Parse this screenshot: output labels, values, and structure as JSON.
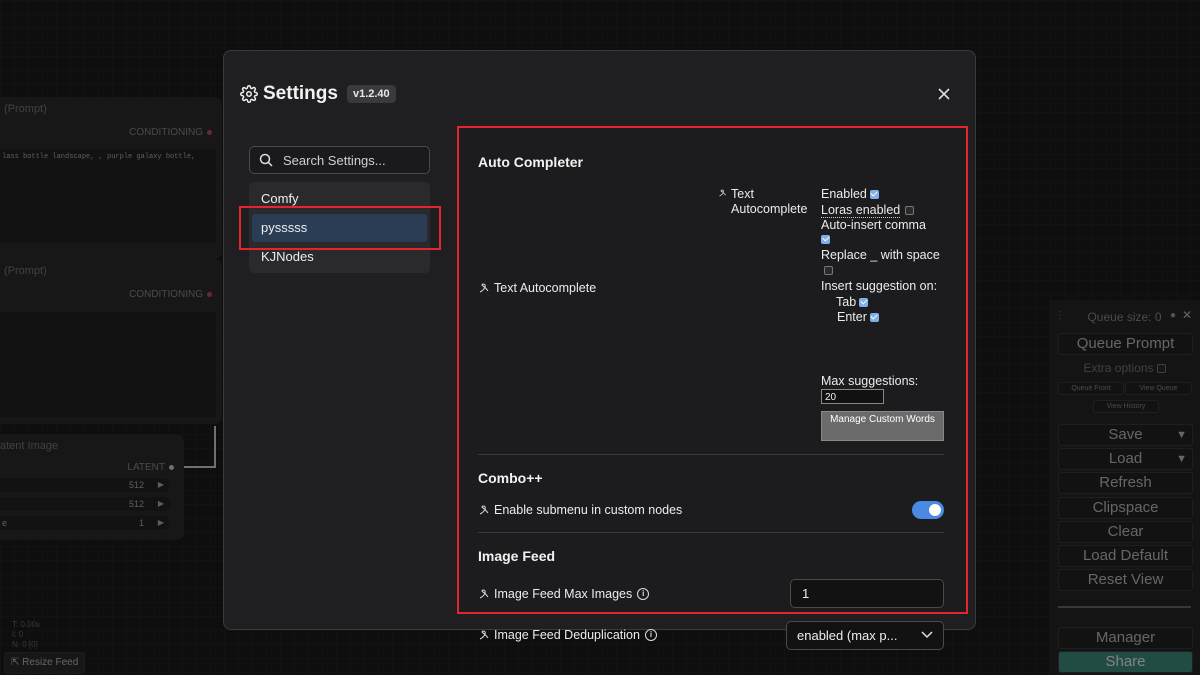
{
  "background": {
    "node1": {
      "title": "(Prompt)",
      "output": "CONDITIONING",
      "prompt_text": "lass bottle landscape, , purple galaxy bottle,"
    },
    "node2": {
      "title": "(Prompt)",
      "output": "CONDITIONING"
    },
    "node3": {
      "title": "atent Image",
      "output": "LATENT",
      "width": "512",
      "height": "512",
      "batch": "1",
      "batch_label": "e"
    },
    "stats": [
      "T: 0.00s",
      "I: 0",
      "N: 0 [0]"
    ],
    "resize_feed": "Resize Feed",
    "accent_colors": {
      "conditioning_dot": "#c04a5a",
      "latent_dot": "#c8c8c8"
    }
  },
  "queue_menu": {
    "queue_size": "Queue size: 0",
    "queue_prompt": "Queue Prompt",
    "extra_options": "Extra options",
    "queue_front": "Queue Front",
    "view_queue": "View Queue",
    "view_history": "View History",
    "save": "Save",
    "load": "Load",
    "refresh": "Refresh",
    "clipspace": "Clipspace",
    "clear": "Clear",
    "load_default": "Load Default",
    "reset_view": "Reset View",
    "manager": "Manager",
    "share": "Share",
    "share_color": "#3c8a7a"
  },
  "settings": {
    "title": "Settings",
    "version": "v1.2.40",
    "search_placeholder": "Search Settings...",
    "categories": [
      "Comfy",
      "pysssss",
      "KJNodes"
    ],
    "selected_category": "pysssss",
    "highlight_color": "#e3262b",
    "sections": {
      "auto_completer": {
        "heading": "Auto Completer",
        "setting_label": "Text Autocomplete",
        "sub_label": "Text Autocomplete",
        "enabled": "Enabled",
        "enabled_checked": true,
        "loras_enabled": "Loras enabled",
        "loras_checked": false,
        "auto_insert_comma": "Auto-insert comma",
        "comma_checked": true,
        "replace_underscore": "Replace _ with space",
        "replace_checked": false,
        "insert_on": "Insert suggestion on:",
        "tab": "Tab",
        "tab_checked": true,
        "enter": "Enter",
        "enter_checked": true,
        "max_suggestions": "Max suggestions:",
        "max_value": "20",
        "manage_button": "Manage Custom Words"
      },
      "combo": {
        "heading": "Combo++",
        "setting_label": "Enable submenu in custom nodes",
        "toggle_on": true
      },
      "image_feed": {
        "heading": "Image Feed",
        "max_images_label": "Image Feed Max Images",
        "max_images_value": "1",
        "dedup_label": "Image Feed Deduplication",
        "dedup_value": "enabled (max p..."
      }
    }
  }
}
